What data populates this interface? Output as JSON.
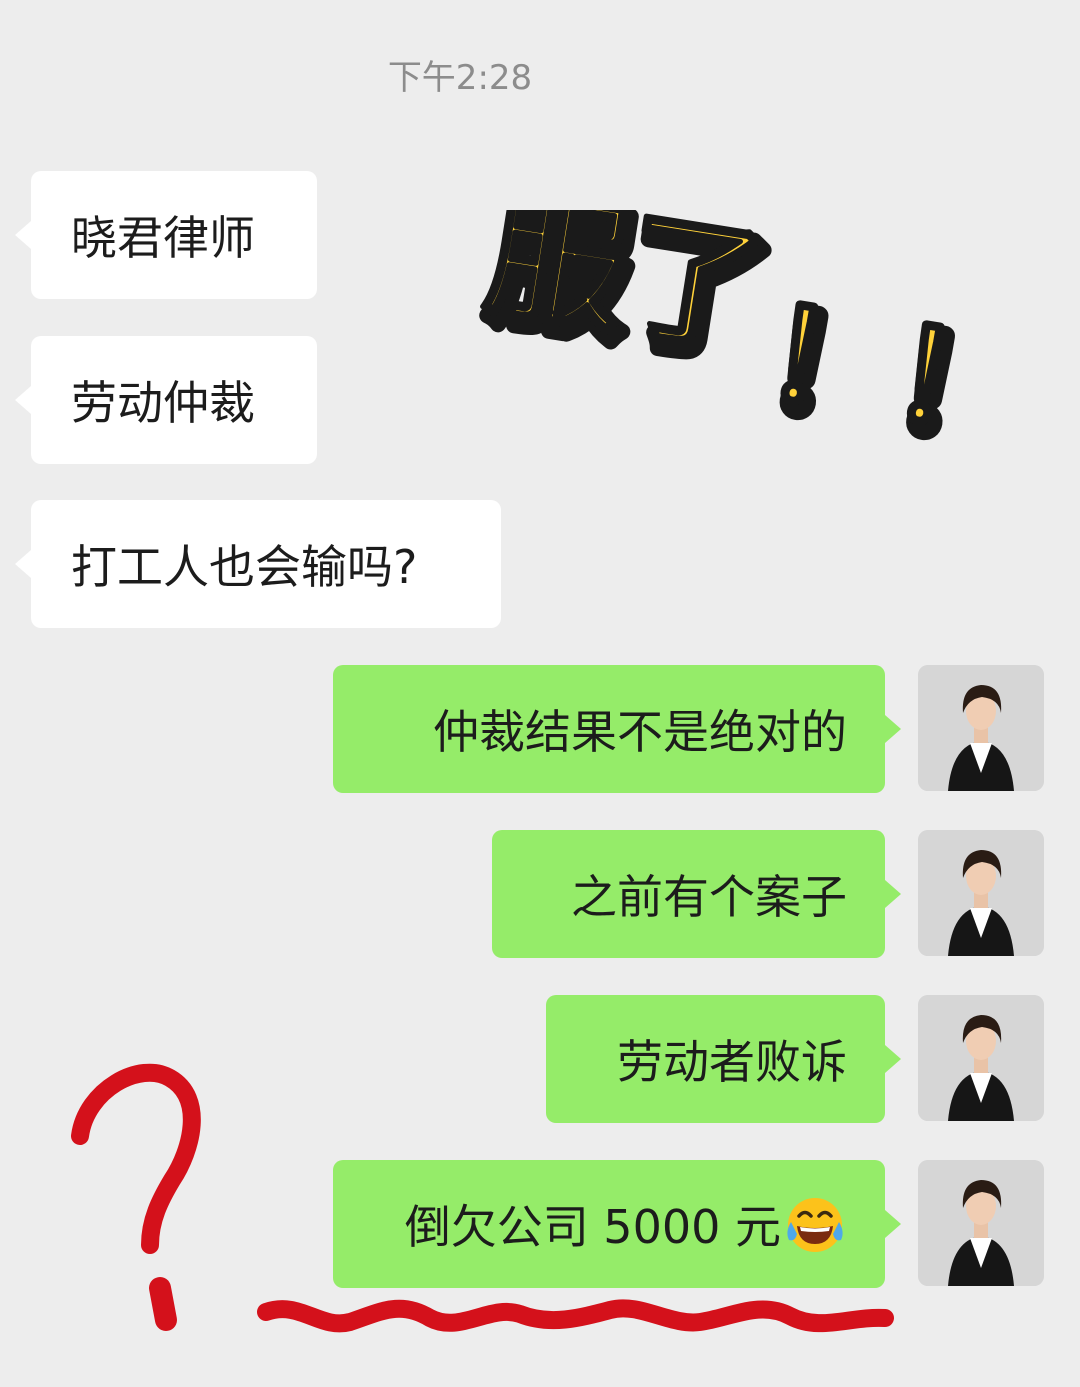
{
  "chat": {
    "timestamp": "下午2:28",
    "incoming": [
      {
        "text": "晓君律师"
      },
      {
        "text": "劳动仲裁"
      },
      {
        "text": "打工人也会输吗?"
      }
    ],
    "outgoing": [
      {
        "text": "仲裁结果不是绝对的"
      },
      {
        "text": "之前有个案子"
      },
      {
        "text": "劳动者败诉"
      },
      {
        "text": "倒欠公司 5000 元",
        "emoji": "face-with-tears-of-joy-icon"
      }
    ]
  },
  "sticker": {
    "text_main": "服了",
    "text_marks": "！！",
    "fill_color": "#ffd23a",
    "outline_color": "#1a1a1a"
  },
  "annotations": {
    "question_mark": "?",
    "ink_color": "#d4111b"
  },
  "colors": {
    "background": "#ededed",
    "incoming_bubble": "#ffffff",
    "outgoing_bubble": "#95ec69"
  }
}
